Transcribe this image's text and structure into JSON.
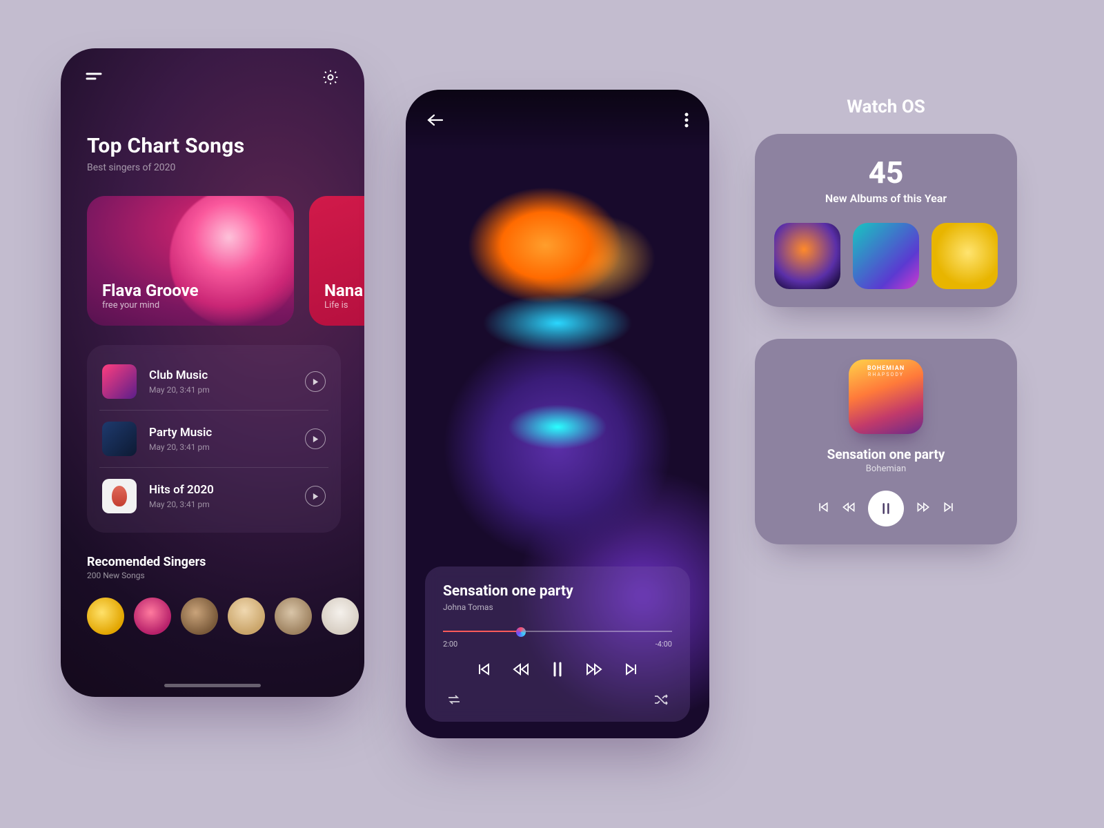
{
  "phoneA": {
    "title": "Top Chart Songs",
    "subtitle": "Best singers of 2020",
    "featured": [
      {
        "title": "Flava Groove",
        "subtitle": "free your mind"
      },
      {
        "title": "Nana",
        "subtitle": "Life is"
      }
    ],
    "songs": [
      {
        "title": "Club Music",
        "meta": "May 20, 3:41 pm"
      },
      {
        "title": "Party Music",
        "meta": "May 20, 3:41 pm"
      },
      {
        "title": "Hits of 2020",
        "meta": "May 20, 3:41 pm"
      }
    ],
    "recommended": {
      "title": "Recomended Singers",
      "subtitle": "200  New Songs"
    }
  },
  "phoneB": {
    "track": {
      "title": "Sensation one party",
      "artist": "Johna Tomas"
    },
    "time": {
      "elapsed": "2:00",
      "remaining": "-4:00"
    }
  },
  "watch": {
    "heading": "Watch OS",
    "stat": {
      "value": "45",
      "label": "New Albums of this Year"
    },
    "player": {
      "coverTop": "BOHEMIAN",
      "coverSub": "RHAPSODY",
      "title": "Sensation one party",
      "artist": "Bohemian"
    }
  }
}
